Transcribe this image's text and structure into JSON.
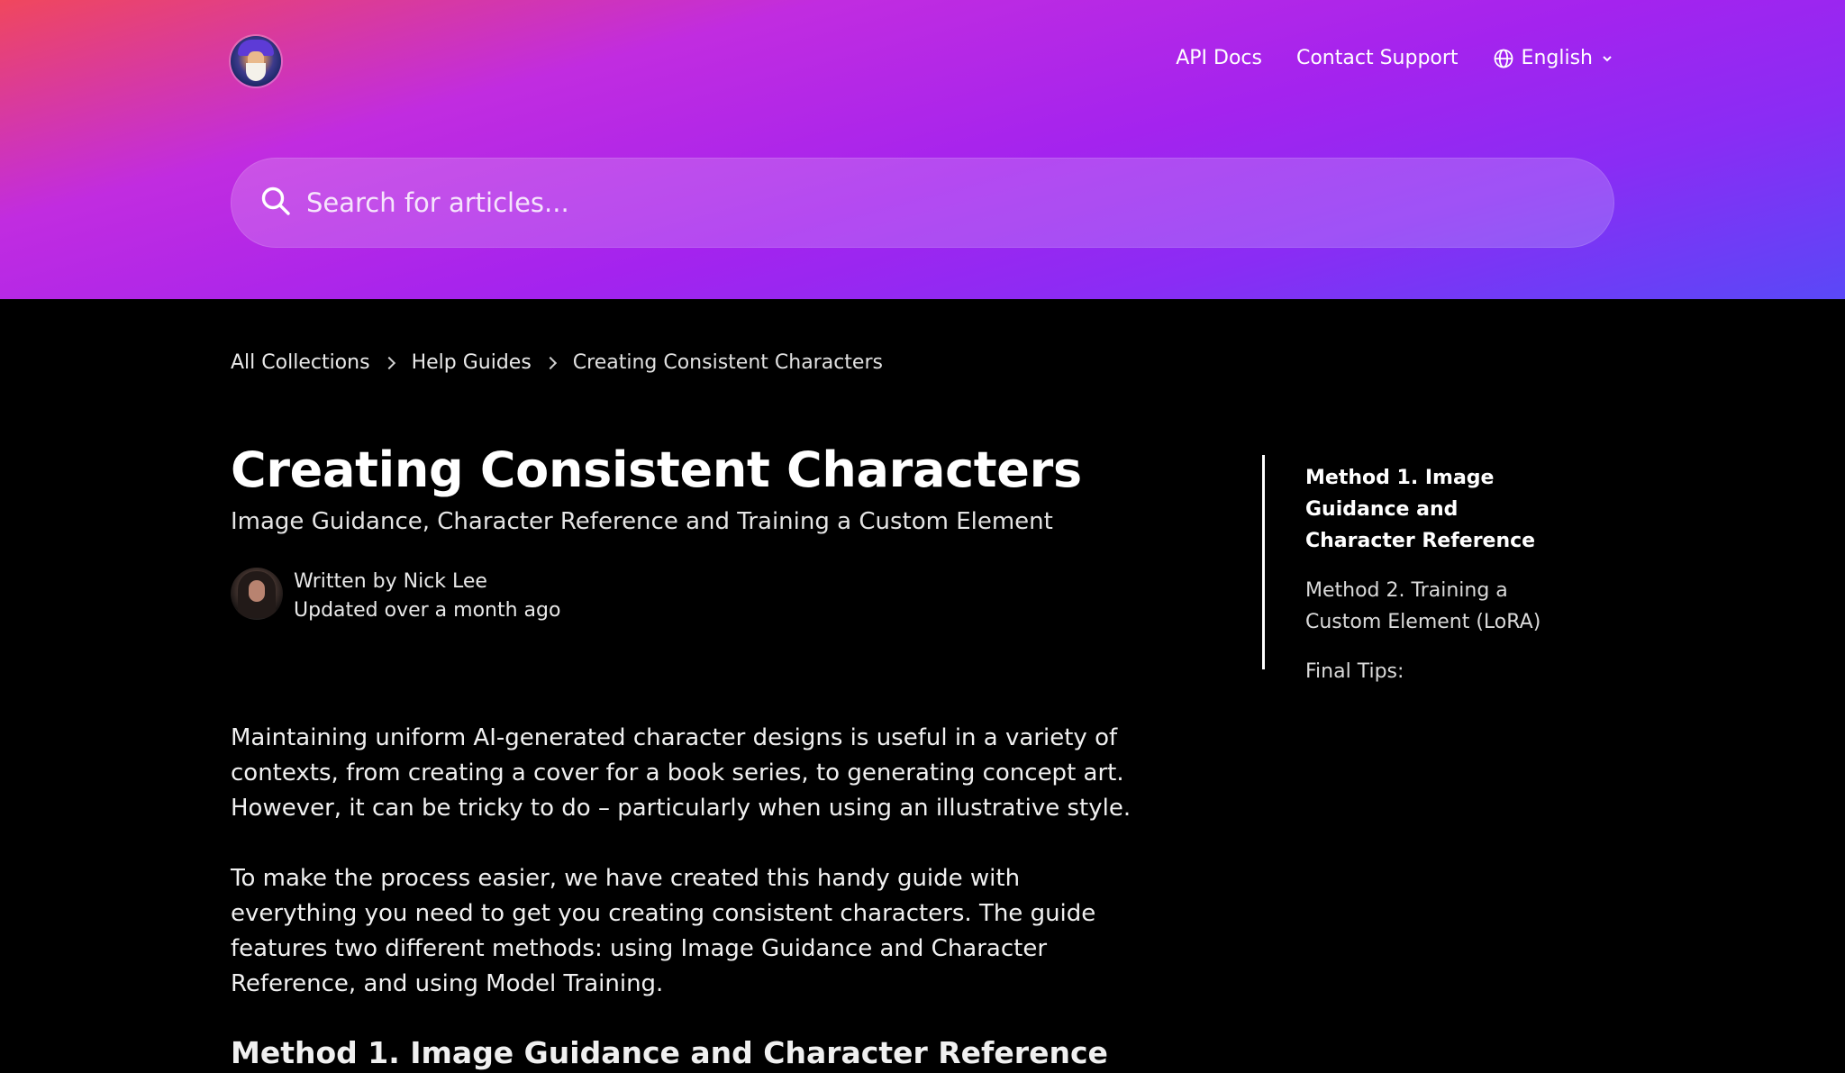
{
  "header": {
    "logo_icon": "wizard-avatar-logo",
    "nav": {
      "api_docs": "API Docs",
      "contact_support": "Contact Support",
      "language": "English",
      "language_icon": "globe-icon",
      "dropdown_icon": "chevron-down-icon"
    },
    "search": {
      "icon": "search-icon",
      "placeholder": "Search for articles..."
    },
    "colors": {
      "gradient_start": "#f0475d",
      "gradient_mid": "#a423ee",
      "gradient_end": "#5a48f7"
    }
  },
  "breadcrumb": {
    "items": [
      "All Collections",
      "Help Guides",
      "Creating Consistent Characters"
    ],
    "separator_icon": "chevron-right-icon"
  },
  "article": {
    "title": "Creating Consistent Characters",
    "subtitle": "Image Guidance, Character Reference and Training a Custom Element",
    "author": {
      "written_by": "Written by Nick Lee",
      "updated": "Updated over a month ago"
    },
    "paragraphs": [
      "Maintaining uniform AI-generated character designs is useful in a variety of contexts, from creating a cover for a book series, to generating concept art. However, it can be tricky to do – particularly when using an illustrative style.",
      "To make the process easier, we have created this handy guide with everything you need to get you creating consistent characters. The guide features two different methods: using Image Guidance and Character Reference, and using Model Training."
    ],
    "section_heading": "Method 1. Image Guidance and Character Reference"
  },
  "toc": {
    "items": [
      "Method 1. Image Guidance and Character Reference",
      "Method 2. Training a Custom Element (LoRA)",
      "Final Tips:"
    ],
    "active_index": 0
  }
}
